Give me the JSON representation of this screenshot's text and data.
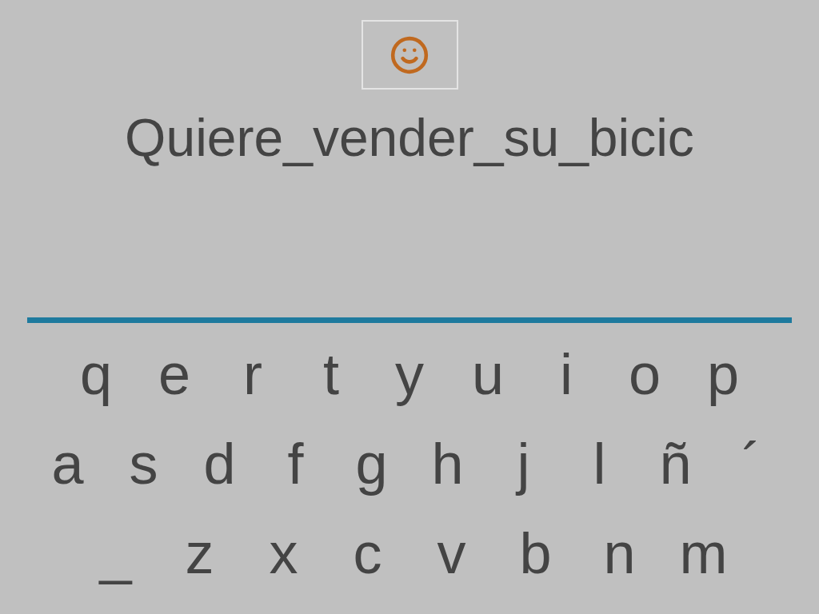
{
  "word": "Quiere_vender_su_bicic",
  "keyboard": {
    "rows": [
      [
        "q",
        "e",
        "r",
        "t",
        "y",
        "u",
        "i",
        "o",
        "p"
      ],
      [
        "a",
        "s",
        "d",
        "f",
        "g",
        "h",
        "j",
        "l",
        "ñ",
        "´"
      ],
      [
        "_",
        "z",
        "x",
        "c",
        "v",
        "b",
        "n",
        "m"
      ]
    ]
  }
}
